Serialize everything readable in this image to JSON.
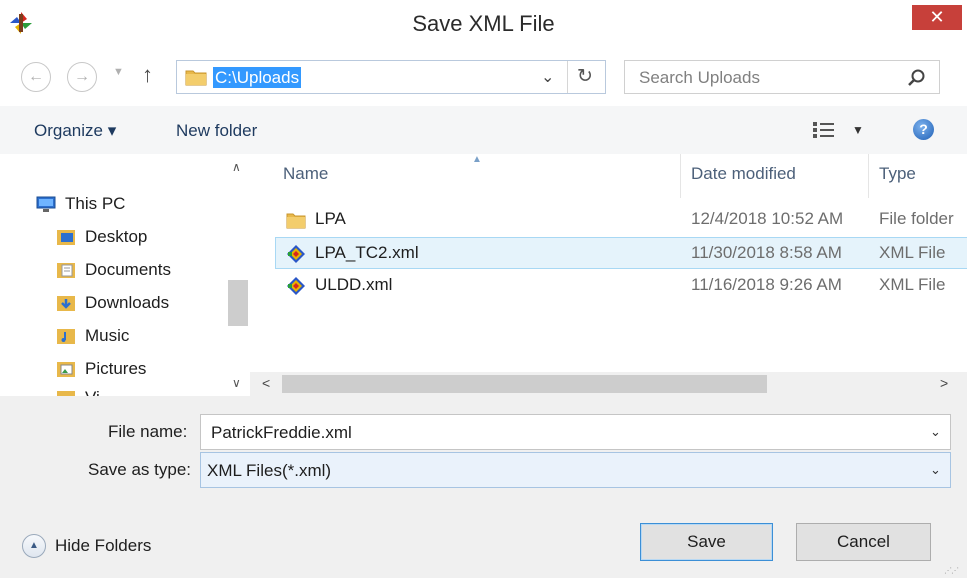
{
  "window": {
    "title": "Save XML File",
    "close_label": "✕"
  },
  "nav": {
    "address": "C:\\Uploads",
    "search_placeholder": "Search Uploads"
  },
  "toolbar": {
    "organize_label": "Organize ▾",
    "new_folder_label": "New folder"
  },
  "sidebar": {
    "items": [
      {
        "label": "This PC",
        "icon": "computer-icon"
      },
      {
        "label": "Desktop",
        "icon": "desktop-folder-icon"
      },
      {
        "label": "Documents",
        "icon": "documents-folder-icon"
      },
      {
        "label": "Downloads",
        "icon": "downloads-folder-icon"
      },
      {
        "label": "Music",
        "icon": "music-folder-icon"
      },
      {
        "label": "Pictures",
        "icon": "pictures-folder-icon"
      },
      {
        "label": "Vi...",
        "icon": "videos-folder-icon"
      }
    ]
  },
  "filelist": {
    "columns": [
      "Name",
      "Date modified",
      "Type"
    ],
    "rows": [
      {
        "name": "LPA",
        "date": "12/4/2018 10:52 AM",
        "type": "File folder",
        "icon": "folder-icon"
      },
      {
        "name": "LPA_TC2.xml",
        "date": "11/30/2018 8:58 AM",
        "type": "XML File",
        "icon": "xml-file-icon"
      },
      {
        "name": "ULDD.xml",
        "date": "11/16/2018 9:26 AM",
        "type": "XML File",
        "icon": "xml-file-icon"
      }
    ],
    "selected_row": "LPA_TC2.xml"
  },
  "form": {
    "file_name_label": "File name:",
    "file_name_value": "PatrickFreddie.xml",
    "save_type_label": "Save as type:",
    "save_type_value": "XML Files(*.xml)"
  },
  "footer": {
    "hide_folders_label": "Hide Folders",
    "save_label": "Save",
    "cancel_label": "Cancel"
  },
  "colors": {
    "accent": "#3399ff",
    "close_red": "#c7403a",
    "selection_bg": "#e5f3fb",
    "folder_yellow": "#e8b84a"
  }
}
